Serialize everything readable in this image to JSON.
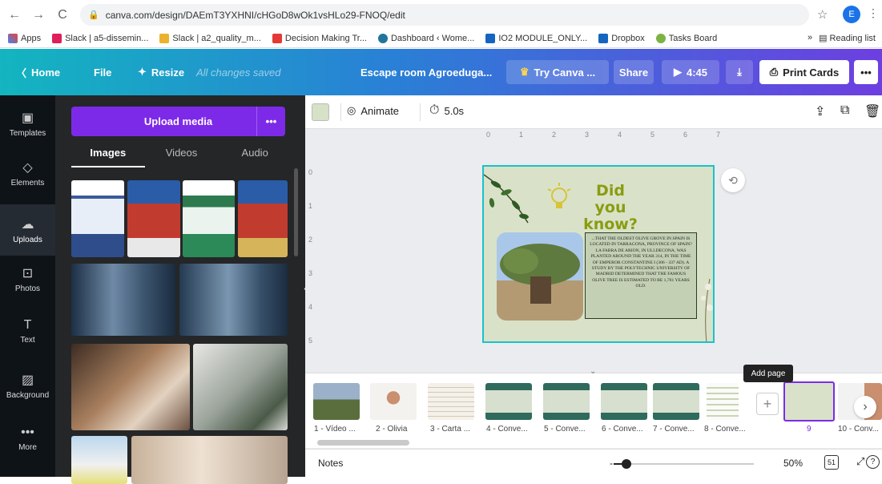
{
  "browser": {
    "url": "canva.com/design/DAEmT3YXHNI/cHGoD8wOk1vsHLo29-FNOQ/edit",
    "profile_initial": "E",
    "bookmarks": [
      "Apps",
      "Slack | a5-dissemin...",
      "Slack | a2_quality_m...",
      "Decision Making Tr...",
      "Dashboard ‹ Wome...",
      "IO2 MODULE_ONLY...",
      "Dropbox",
      "Tasks Board"
    ],
    "overflow": "»",
    "reading_list": "Reading list"
  },
  "topbar": {
    "home": "Home",
    "file": "File",
    "resize": "Resize",
    "saved_status": "All changes saved",
    "design_title": "Escape room Agroeduga...",
    "try_canva": "Try Canva ...",
    "share": "Share",
    "duration": "4:45",
    "print_cards": "Print Cards",
    "more": "•••"
  },
  "sidebar": {
    "items": [
      {
        "label": "Templates",
        "icon": "templates-icon"
      },
      {
        "label": "Elements",
        "icon": "elements-icon"
      },
      {
        "label": "Uploads",
        "icon": "uploads-icon"
      },
      {
        "label": "Photos",
        "icon": "photos-icon"
      },
      {
        "label": "Text",
        "icon": "text-icon"
      },
      {
        "label": "Background",
        "icon": "background-icon"
      },
      {
        "label": "More",
        "icon": "more-icon"
      }
    ]
  },
  "panel": {
    "upload_label": "Upload media",
    "upload_more": "•••",
    "tabs": [
      "Images",
      "Videos",
      "Audio"
    ]
  },
  "editor": {
    "animate": "Animate",
    "duration": "5.0s",
    "ruler_h": [
      "0",
      "1",
      "2",
      "3",
      "4",
      "5",
      "6",
      "7"
    ],
    "ruler_v": [
      "0",
      "1",
      "2",
      "3",
      "4",
      "5"
    ]
  },
  "slide": {
    "title": "Did you know?",
    "body": "...that the oldest olive grove in Spain is located in Tarragona, province of Spain? La Fabra de Arion, in Ulldecona, was planted around the year 314, in the time of Emperor Constantine I (306 - 337 AD). A study by the Polytechnic University of Madrid determined that the famous olive tree is estimated to be 1,701 years old."
  },
  "pages": {
    "labels": [
      "1 - Vídeo ...",
      "2 - Olivia",
      "3 - Carta ...",
      "4 - Conve...",
      "5 - Conve...",
      "6 - Conve...",
      "7 - Conve...",
      "8 - Conve...",
      "9",
      "10 - Conv..."
    ],
    "tooltip": "Add page"
  },
  "footer": {
    "notes": "Notes",
    "zoom": "50%",
    "page_count": "51"
  },
  "colors": {
    "accent": "#7d2ae8",
    "selection": "#19c2c9",
    "slide_bg": "#d9e2c8",
    "title_green": "#8a9c10"
  }
}
